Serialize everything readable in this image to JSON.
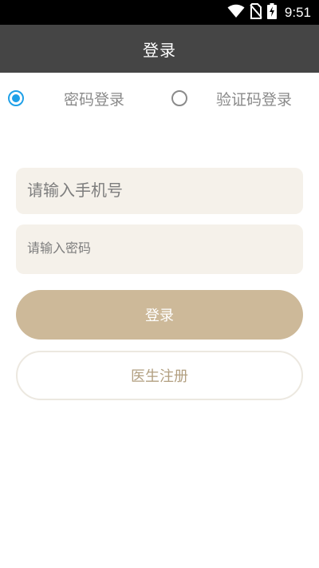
{
  "status_bar": {
    "time": "9:51",
    "icons": [
      "wifi-icon",
      "no-sim-icon",
      "battery-charging-icon"
    ]
  },
  "title_bar": {
    "title": "登录"
  },
  "login_mode": {
    "options": [
      {
        "label": "密码登录",
        "selected": true
      },
      {
        "label": "验证码登录",
        "selected": false
      }
    ],
    "accent_color": "#1fa0e8"
  },
  "form": {
    "phone_placeholder": "请输入手机号",
    "password_placeholder": "请输入密码"
  },
  "buttons": {
    "login_label": "登录",
    "register_label": "医生注册"
  },
  "colors": {
    "title_bar": "#454545",
    "input_background": "#f5f1ea",
    "primary_button": "#cdb999",
    "secondary_text": "#b29f80"
  }
}
